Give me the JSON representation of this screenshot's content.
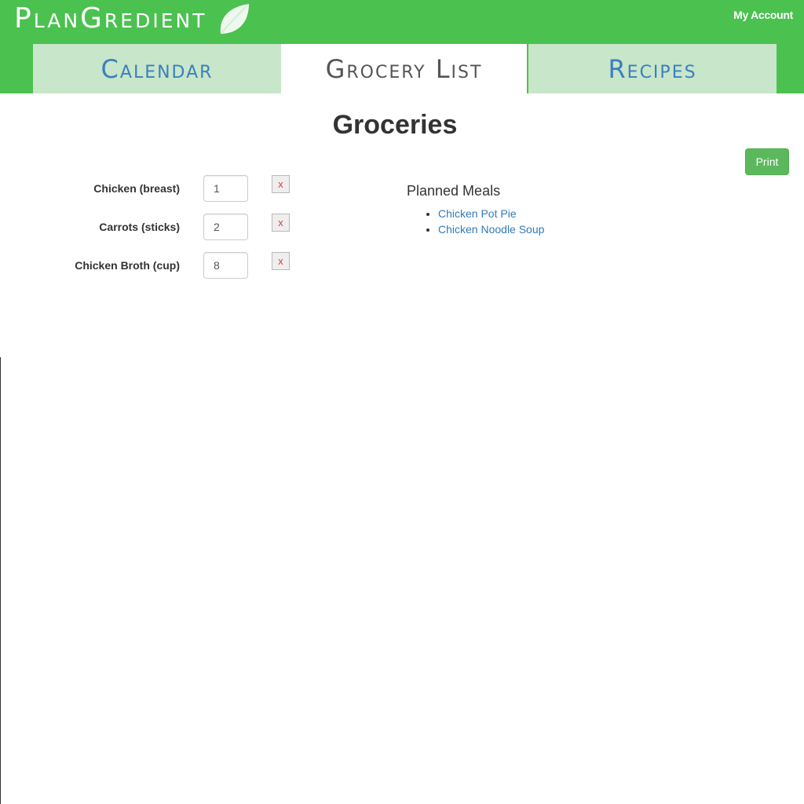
{
  "header": {
    "logo_text": "PlanGredient",
    "account_link": "My Account"
  },
  "tabs": [
    {
      "label": "Calendar",
      "active": false
    },
    {
      "label": "Grocery List",
      "active": true
    },
    {
      "label": "Recipes",
      "active": false
    }
  ],
  "main": {
    "title": "Groceries",
    "print_label": "Print",
    "groceries": [
      {
        "label": "Chicken (breast)",
        "quantity": "1",
        "remove_label": "x"
      },
      {
        "label": "Carrots (sticks)",
        "quantity": "2",
        "remove_label": "x"
      },
      {
        "label": "Chicken Broth (cup)",
        "quantity": "8",
        "remove_label": "x"
      }
    ],
    "planned_meals": {
      "title": "Planned Meals",
      "items": [
        "Chicken Pot Pie",
        "Chicken Noodle Soup"
      ]
    }
  },
  "colors": {
    "header_bg": "#4bc150",
    "tab_inactive_bg": "#c8e6c9",
    "tab_inactive_text": "#3a7fbf",
    "link": "#337ab7",
    "print_button": "#5cb85c",
    "remove_x": "#e23b3b"
  },
  "icons": {
    "logo": "leaf-icon"
  }
}
